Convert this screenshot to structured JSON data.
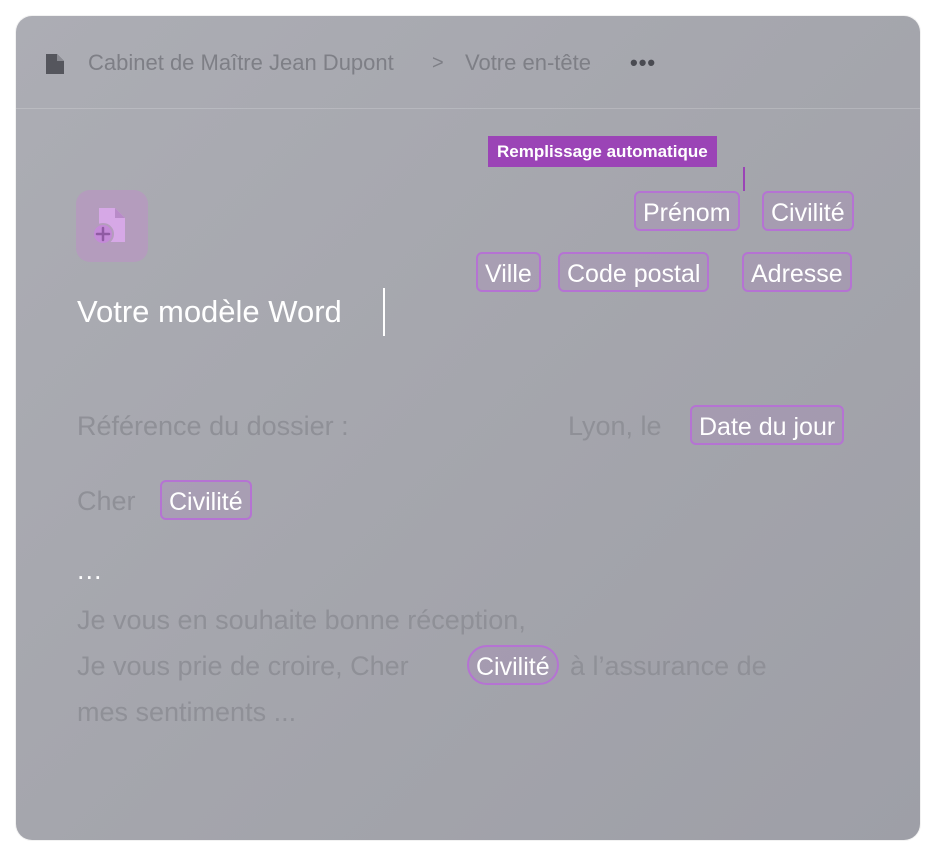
{
  "breadcrumb": {
    "items": [
      "Cabinet de Maître Jean Dupont",
      "Votre en-tête"
    ],
    "separator": ">",
    "more": "•••"
  },
  "autofill": {
    "label": "Remplissage automatique",
    "fields": [
      "Prénom",
      "Civilité",
      "Ville",
      "Code postal",
      "Adresse"
    ]
  },
  "template": {
    "title": "Votre modèle Word"
  },
  "letter": {
    "reference_label": "Référence du dossier :",
    "place_label": "Lyon, le",
    "date_tag": "Date du jour",
    "greeting": "Cher",
    "greeting_tag": "Civilité",
    "ellipsis": "...",
    "closing_line1": "Je vous en souhaite bonne réception,",
    "closing_line2_before": "Je vous prie de croire, Cher",
    "closing_tag": "Civilité",
    "closing_line2_after": "à l’assurance de",
    "closing_line3": "mes sentiments ..."
  },
  "colors": {
    "accent": "#9b44b6",
    "tag_border": "#b573d3",
    "background": "#a6a7ae"
  },
  "icons": {
    "doc": "document-icon",
    "template": "add-document-icon",
    "more": "more-horizontal-icon"
  }
}
